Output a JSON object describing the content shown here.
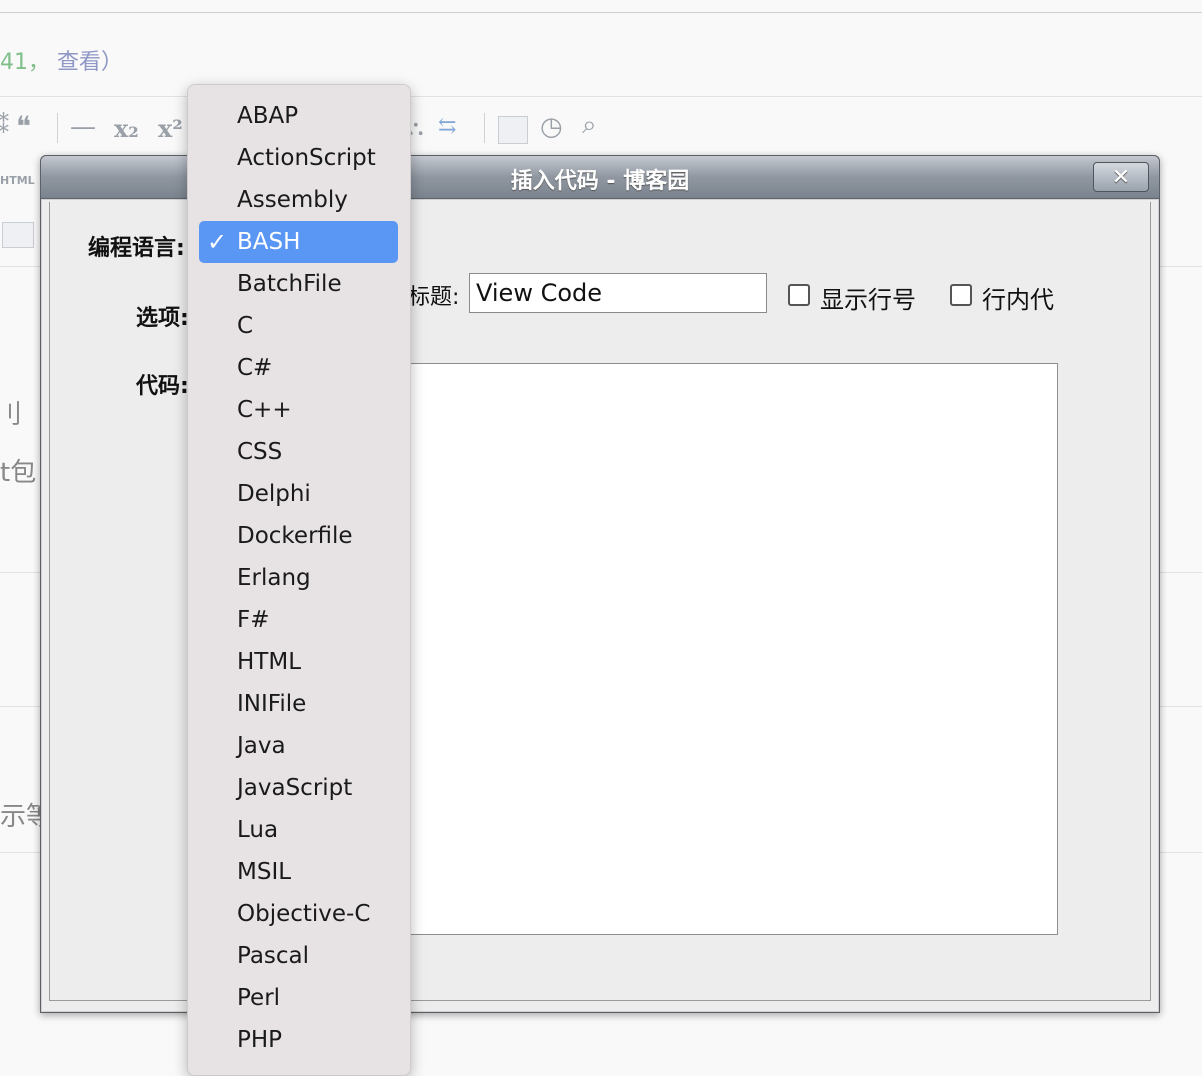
{
  "background": {
    "meta_count": "41，",
    "meta_link": "查看",
    "meta_paren": "）",
    "toolbar_quote": "❝",
    "toolbar_dash": "—",
    "toolbar_sub": "x₂",
    "toolbar_sup": "x²",
    "html_label": "HTML",
    "text_fragment_1": "刂",
    "text_fragment_2": "t包",
    "text_fragment_3": "示等"
  },
  "dialog": {
    "title": "插入代码 - 博客园",
    "close_label": "✕",
    "language_label": "编程语言:",
    "options_label": "选项:",
    "code_label": "代码:",
    "title_field_label": "标题:",
    "title_field_value": "View Code",
    "show_line_numbers_label": "显示行号",
    "inline_code_label": "行内代"
  },
  "language_dropdown": {
    "selected": "BASH",
    "check_glyph": "✓",
    "options": [
      "ABAP",
      "ActionScript",
      "Assembly",
      "BASH",
      "BatchFile",
      "C",
      "C#",
      "C++",
      "CSS",
      "Delphi",
      "Dockerfile",
      "Erlang",
      "F#",
      "HTML",
      "INIFile",
      "Java",
      "JavaScript",
      "Lua",
      "MSIL",
      "Objective-C",
      "Pascal",
      "Perl",
      "PHP"
    ]
  },
  "colors": {
    "selection": "#5a96f3",
    "title_bar": "#8a919b"
  }
}
